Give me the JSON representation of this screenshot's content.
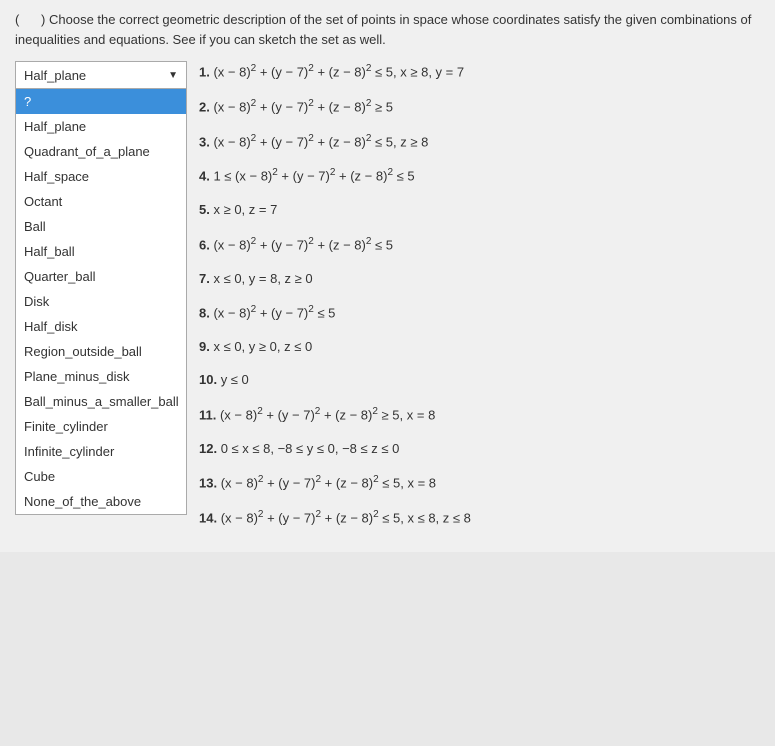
{
  "page": {
    "question_prefix": "(",
    "question_blank": "    ",
    "question_suffix": ") Choose the correct geometric description of the set of points in space whose coordinates satisfy the given combinations of inequalities and equations. See if you can sketch the set as well."
  },
  "dropdown": {
    "current_value": "Half_plane",
    "options": [
      {
        "label": "?",
        "selected": true
      },
      {
        "label": "Half_plane"
      },
      {
        "label": "Quadrant_of_a_plane"
      },
      {
        "label": "Half_space"
      },
      {
        "label": "Octant"
      },
      {
        "label": "Ball"
      },
      {
        "label": "Half_ball"
      },
      {
        "label": "Quarter_ball"
      },
      {
        "label": "Disk"
      },
      {
        "label": "Half_disk"
      },
      {
        "label": "Region_outside_ball"
      },
      {
        "label": "Plane_minus_disk"
      },
      {
        "label": "Ball_minus_a_smaller_ball"
      },
      {
        "label": "Finite_cylinder"
      },
      {
        "label": "Infinite_cylinder"
      },
      {
        "label": "Cube"
      },
      {
        "label": "None_of_the_above"
      }
    ]
  },
  "problems": [
    {
      "number": "1.",
      "html": "(x − 8)² + (y − 7)² + (z − 8)² ≤ 5, x ≥ 8, y = 7"
    },
    {
      "number": "2.",
      "html": "(x − 8)² + (y − 7)² + (z − 8)² ≥ 5"
    },
    {
      "number": "3.",
      "html": "(x − 8)² + (y − 7)² + (z − 8)² ≤ 5, z ≥ 8"
    },
    {
      "number": "4.",
      "html": "1 ≤ (x − 8)² + (y − 7)² + (z − 8)² ≤ 5"
    },
    {
      "number": "5.",
      "html": "x ≥ 0, z = 7"
    },
    {
      "number": "6.",
      "html": "(x − 8)² + (y − 7)² + (z − 8)² ≤ 5"
    },
    {
      "number": "7.",
      "html": "x ≤ 0, y = 8, z ≥ 0"
    },
    {
      "number": "8.",
      "html": "(x − 8)² + (y − 7)² ≤ 5"
    },
    {
      "number": "9.",
      "html": "x ≤ 0, y ≥ 0, z ≤ 0"
    },
    {
      "number": "10.",
      "html": "y ≤ 0"
    },
    {
      "number": "11.",
      "html": "(x − 8)² + (y − 7)² + (z − 8)² ≥ 5, x = 8"
    },
    {
      "number": "12.",
      "html": "0 ≤ x ≤ 8, −8 ≤ y ≤ 0, −8 ≤ z ≤ 0"
    },
    {
      "number": "13.",
      "html": "(x − 8)² + (y − 7)² + (z − 8)² ≤ 5, x = 8"
    },
    {
      "number": "14.",
      "html": "(x − 8)² + (y − 7)² + (z − 8)² ≤ 5, x ≤ 8, z ≤ 8"
    }
  ]
}
